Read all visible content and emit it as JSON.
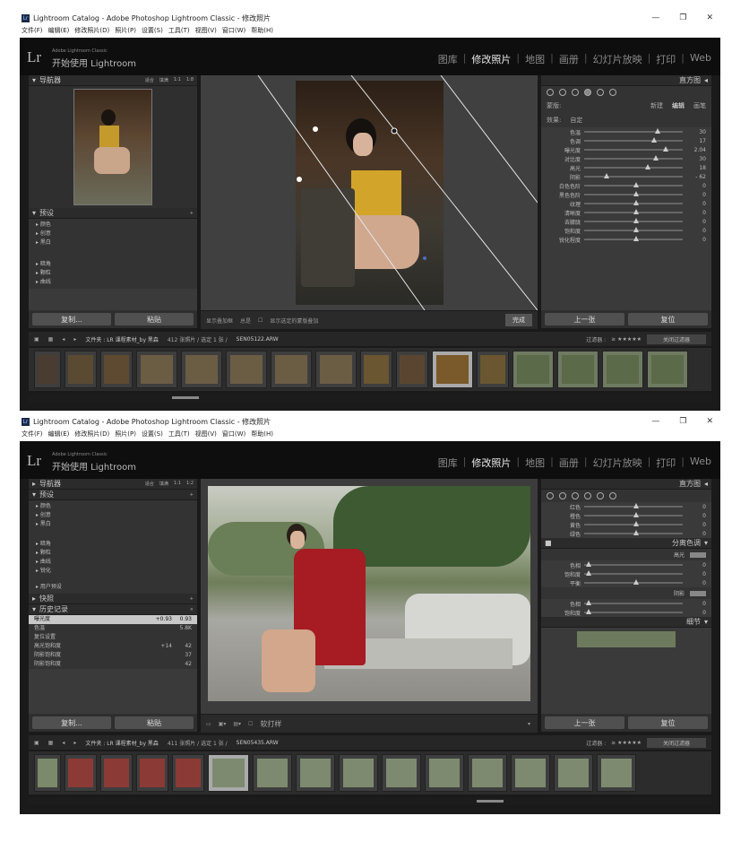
{
  "windows": [
    {
      "title": "Lightroom Catalog - Adobe Photoshop Lightroom Classic - 修改照片",
      "menu": [
        "文件(F)",
        "编辑(E)",
        "修改照片(D)",
        "照片(P)",
        "设置(S)",
        "工具(T)",
        "视图(V)",
        "窗口(W)",
        "帮助(H)"
      ],
      "lr_sub": "Adobe Lightroom Classic",
      "lr_title": "开始使用 Lightroom",
      "modules": [
        "图库",
        "修改照片",
        "地图",
        "画册",
        "幻灯片放映",
        "打印",
        "Web"
      ],
      "active_module": "修改照片",
      "navigator": {
        "label": "导航器",
        "zooms": [
          "适合",
          "填满",
          "1:1",
          "1:8"
        ]
      },
      "presets": {
        "label": "预设",
        "items": [
          "颜色",
          "创意",
          "黑白",
          "暗角",
          "颗粒",
          "曲线"
        ]
      },
      "left_buttons": [
        "复制...",
        "粘贴"
      ],
      "toolbar": {
        "show_overlay": "显示叠加框",
        "always": "总是",
        "show_mask": "显示选定的蒙版叠加",
        "done": "完成"
      },
      "histogram_label": "直方图",
      "mask_tabs": {
        "label": "蒙版:",
        "new": "新建",
        "edit": "编辑",
        "brush": "画笔"
      },
      "effect": {
        "label": "效果:",
        "value": "自定"
      },
      "sliders": [
        {
          "label": "色温",
          "value": "30",
          "pos": 0.72
        },
        {
          "label": "色调",
          "value": "17",
          "pos": 0.68
        },
        {
          "label": "曝光度",
          "value": "2.04",
          "pos": 0.8
        },
        {
          "label": "对比度",
          "value": "30",
          "pos": 0.7
        },
        {
          "label": "高光",
          "value": "18",
          "pos": 0.62
        },
        {
          "label": "阴影",
          "value": "- 62",
          "pos": 0.2
        },
        {
          "label": "白色色阶",
          "value": "0",
          "pos": 0.5
        },
        {
          "label": "黑色色阶",
          "value": "0",
          "pos": 0.5
        },
        {
          "label": "纹理",
          "value": "0",
          "pos": 0.5
        },
        {
          "label": "清晰度",
          "value": "0",
          "pos": 0.5
        },
        {
          "label": "去朦胧",
          "value": "0",
          "pos": 0.5
        },
        {
          "label": "饱和度",
          "value": "0",
          "pos": 0.5
        },
        {
          "label": "锐化程度",
          "value": "0",
          "pos": 0.5
        }
      ],
      "right_buttons": [
        "上一张",
        "复位"
      ],
      "filmbar": {
        "folder": "文件夹 : LR 课程素材_by 黑森",
        "count": "412 张照片 / 选定 1 张 /",
        "file": "SEN05122.ARW",
        "filter_label": "过滤器 :",
        "stars": "≥ ★★★★★",
        "filter_value": "关闭过滤器"
      }
    },
    {
      "title": "Lightroom Catalog - Adobe Photoshop Lightroom Classic - 修改照片",
      "menu": [
        "文件(F)",
        "编辑(E)",
        "修改照片(D)",
        "照片(P)",
        "设置(S)",
        "工具(T)",
        "视图(V)",
        "窗口(W)",
        "帮助(H)"
      ],
      "lr_sub": "Adobe Lightroom Classic",
      "lr_title": "开始使用 Lightroom",
      "modules": [
        "图库",
        "修改照片",
        "地图",
        "画册",
        "幻灯片放映",
        "打印",
        "Web"
      ],
      "active_module": "修改照片",
      "navigator": {
        "label": "导航器",
        "zooms": [
          "适合",
          "填满",
          "1:1",
          "1:2"
        ]
      },
      "presets": {
        "label": "预设",
        "items": [
          "颜色",
          "创意",
          "黑白",
          "暗角",
          "颗粒",
          "曲线",
          "锐化",
          "用户预设"
        ]
      },
      "snapshots_label": "快照",
      "history": {
        "label": "历史记录",
        "items": [
          {
            "name": "曝光度",
            "a": "+0.93",
            "b": "0.93"
          },
          {
            "name": "色温",
            "a": "",
            "b": "5.8K"
          },
          {
            "name": "复位设置",
            "a": "",
            "b": ""
          },
          {
            "name": "高光饱和度",
            "a": "+14",
            "b": "42"
          },
          {
            "name": "阴影饱和度",
            "a": "",
            "b": "37"
          },
          {
            "name": "阴影饱和度",
            "a": "",
            "b": "42"
          }
        ]
      },
      "left_buttons": [
        "复制...",
        "粘贴"
      ],
      "toolbar": {
        "softproof": "软打样"
      },
      "histogram_label": "直方图",
      "hsl_sliders": [
        {
          "label": "红色",
          "value": "0",
          "pos": 0.5
        },
        {
          "label": "橙色",
          "value": "0",
          "pos": 0.5
        },
        {
          "label": "黄色",
          "value": "0",
          "pos": 0.5
        },
        {
          "label": "绿色",
          "value": "0",
          "pos": 0.5
        }
      ],
      "split_tone": {
        "label": "分离色调",
        "highlights_label": "高光",
        "shadows_label": "阴影",
        "balance_label": "平衡",
        "sliders": [
          {
            "label": "色相",
            "value": "0",
            "pos": 0.02
          },
          {
            "label": "饱和度",
            "value": "0",
            "pos": 0.02
          },
          {
            "label": "平衡",
            "value": "0",
            "pos": 0.5
          },
          {
            "label": "色相",
            "value": "0",
            "pos": 0.02
          },
          {
            "label": "饱和度",
            "value": "0",
            "pos": 0.02
          }
        ]
      },
      "detail_label": "细节",
      "right_buttons": [
        "上一张",
        "复位"
      ],
      "filmbar": {
        "folder": "文件夹 : LR 课程素材_by 黑森",
        "count": "411 张照片 / 选定 1 张 /",
        "file": "SEN05435.ARW",
        "filter_label": "过滤器 :",
        "stars": "≥ ★★★★★",
        "filter_value": "关闭过滤器"
      }
    }
  ],
  "colors": {
    "lr_bg": "#1a1a1a",
    "panel": "#3a3a3a",
    "accent_text": "#e8e8e8"
  }
}
